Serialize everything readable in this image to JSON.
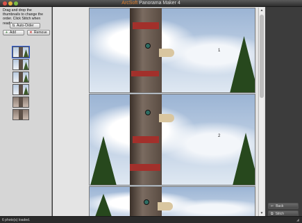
{
  "window": {
    "title_brand": "ArcSoft",
    "title_app": " Panorama Maker 4"
  },
  "left_panel": {
    "instructions": "Drag and drop the thumbnails to change the order. Click Stitch when ready.",
    "auto_order_label": "Auto-Order",
    "add_label": "Add",
    "remove_label": "Remove",
    "thumbnails": [
      {
        "number": "1"
      },
      {
        "number": "2"
      },
      {
        "number": "3"
      },
      {
        "number": "4"
      },
      {
        "number": "5"
      },
      {
        "number": "6"
      }
    ]
  },
  "preview": {
    "frame_labels": [
      "1",
      "2"
    ]
  },
  "right_panel": {
    "back_label": "Back",
    "stitch_label": "Stitch"
  },
  "status": {
    "text": "6 photo(s) loaded."
  },
  "icons": {
    "add": "plus-icon",
    "remove": "x-icon",
    "back": "arrow-left-icon",
    "stitch": "stitch-icon",
    "auto_order": "sort-icon"
  },
  "colors": {
    "brand": "#e0802f",
    "panel_bg": "#d6d6d6",
    "window_bg": "#3a3a3a"
  }
}
